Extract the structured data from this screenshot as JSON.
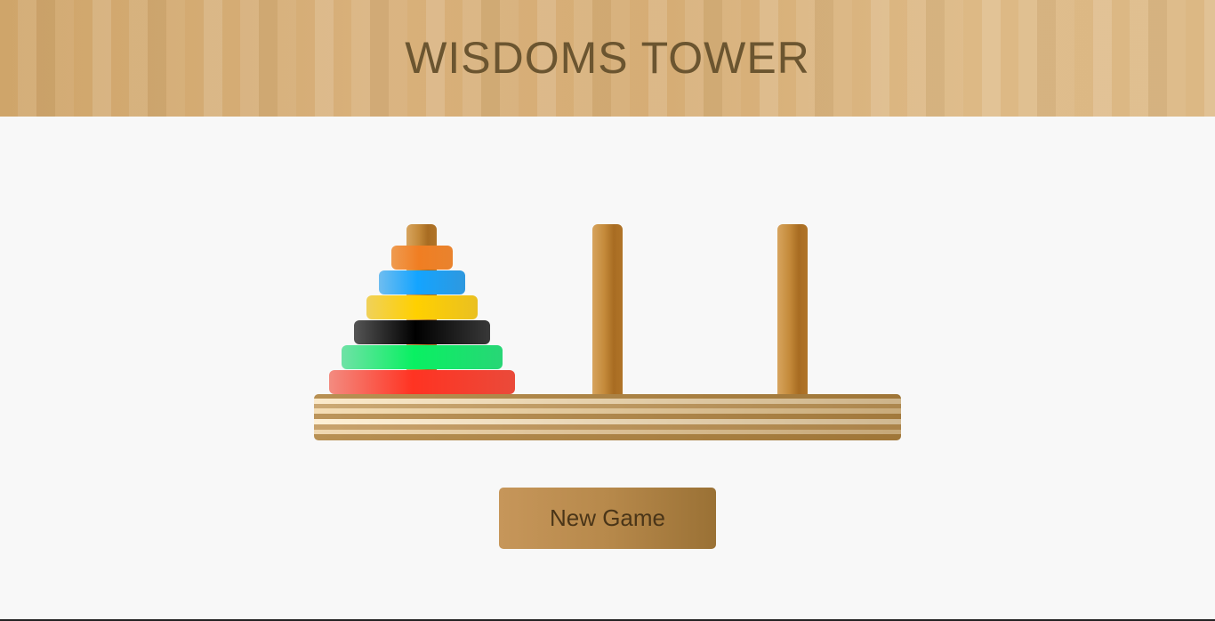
{
  "header": {
    "title": "WISDOMS TOWER"
  },
  "game": {
    "pegs": [
      "left",
      "middle",
      "right"
    ],
    "disks": [
      {
        "peg": "left",
        "level": 1,
        "color_name": "red",
        "colors": [
          "#f38b80",
          "#ff3322",
          "#ea4a3a"
        ]
      },
      {
        "peg": "left",
        "level": 2,
        "color_name": "green",
        "colors": [
          "#6fe2a6",
          "#09f062",
          "#28d676"
        ]
      },
      {
        "peg": "left",
        "level": 3,
        "color_name": "black",
        "colors": [
          "#555555",
          "#000000",
          "#383838"
        ]
      },
      {
        "peg": "left",
        "level": 4,
        "color_name": "yellow",
        "colors": [
          "#f0d15a",
          "#ffd000",
          "#eac021"
        ]
      },
      {
        "peg": "left",
        "level": 5,
        "color_name": "blue",
        "colors": [
          "#6ebdf0",
          "#14a4ff",
          "#2e98df"
        ]
      },
      {
        "peg": "left",
        "level": 6,
        "color_name": "orange",
        "colors": [
          "#ef9b50",
          "#f07e22",
          "#e9832e"
        ]
      }
    ],
    "new_game_label": "New Game"
  },
  "colors": {
    "wood_light": "#d8b07a",
    "wood_dark": "#a86c22",
    "title_text": "#6b5530",
    "button_text": "#4a3518",
    "background": "#f8f8f8"
  }
}
